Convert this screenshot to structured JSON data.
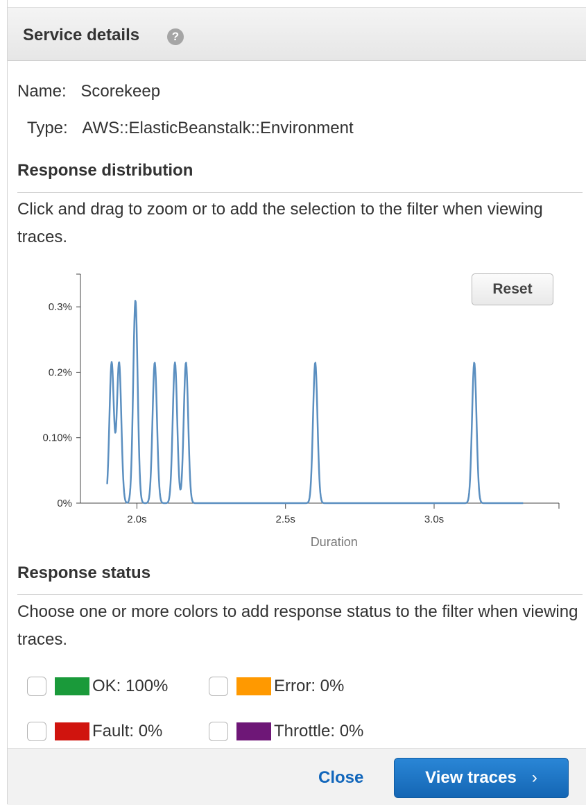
{
  "panel": {
    "title": "Service details",
    "help_icon": "question-circle-icon"
  },
  "service": {
    "name_label": "Name:",
    "name_value": "Scorekeep",
    "type_label": "Type:",
    "type_value": "AWS::ElasticBeanstalk::Environment"
  },
  "distribution": {
    "title": "Response distribution",
    "description": "Click and drag to zoom or to add the selection to the filter when viewing traces.",
    "reset_label": "Reset"
  },
  "chart_data": {
    "type": "line",
    "xlabel": "Duration",
    "ylabel": "",
    "x_ticks": [
      "2.0s",
      "2.5s",
      "3.0s"
    ],
    "y_ticks": [
      "0%",
      "0.10%",
      "0.2%",
      "0.3%"
    ],
    "xlim": [
      1.81,
      3.42
    ],
    "ylim": [
      0,
      0.35
    ],
    "series_color": "#5b8fc0",
    "x_start": 1.9,
    "x_end": 3.3,
    "peaks": [
      {
        "x": 1.915,
        "y": 0.215
      },
      {
        "x": 1.94,
        "y": 0.215
      },
      {
        "x": 1.995,
        "y": 0.31
      },
      {
        "x": 2.06,
        "y": 0.215
      },
      {
        "x": 2.128,
        "y": 0.215
      },
      {
        "x": 2.165,
        "y": 0.215
      },
      {
        "x": 2.6,
        "y": 0.215
      },
      {
        "x": 3.135,
        "y": 0.215
      }
    ]
  },
  "status": {
    "title": "Response status",
    "description": "Choose one or more colors to add response status to the filter when viewing traces.",
    "items": [
      {
        "label": "OK: 100%",
        "color": "#1a9a3a"
      },
      {
        "label": "Error: 0%",
        "color": "#ff9900"
      },
      {
        "label": "Fault: 0%",
        "color": "#d0140e"
      },
      {
        "label": "Throttle: 0%",
        "color": "#6e1777"
      }
    ]
  },
  "footer": {
    "close_label": "Close",
    "view_label": "View traces",
    "view_icon": "chevron-right-icon"
  }
}
